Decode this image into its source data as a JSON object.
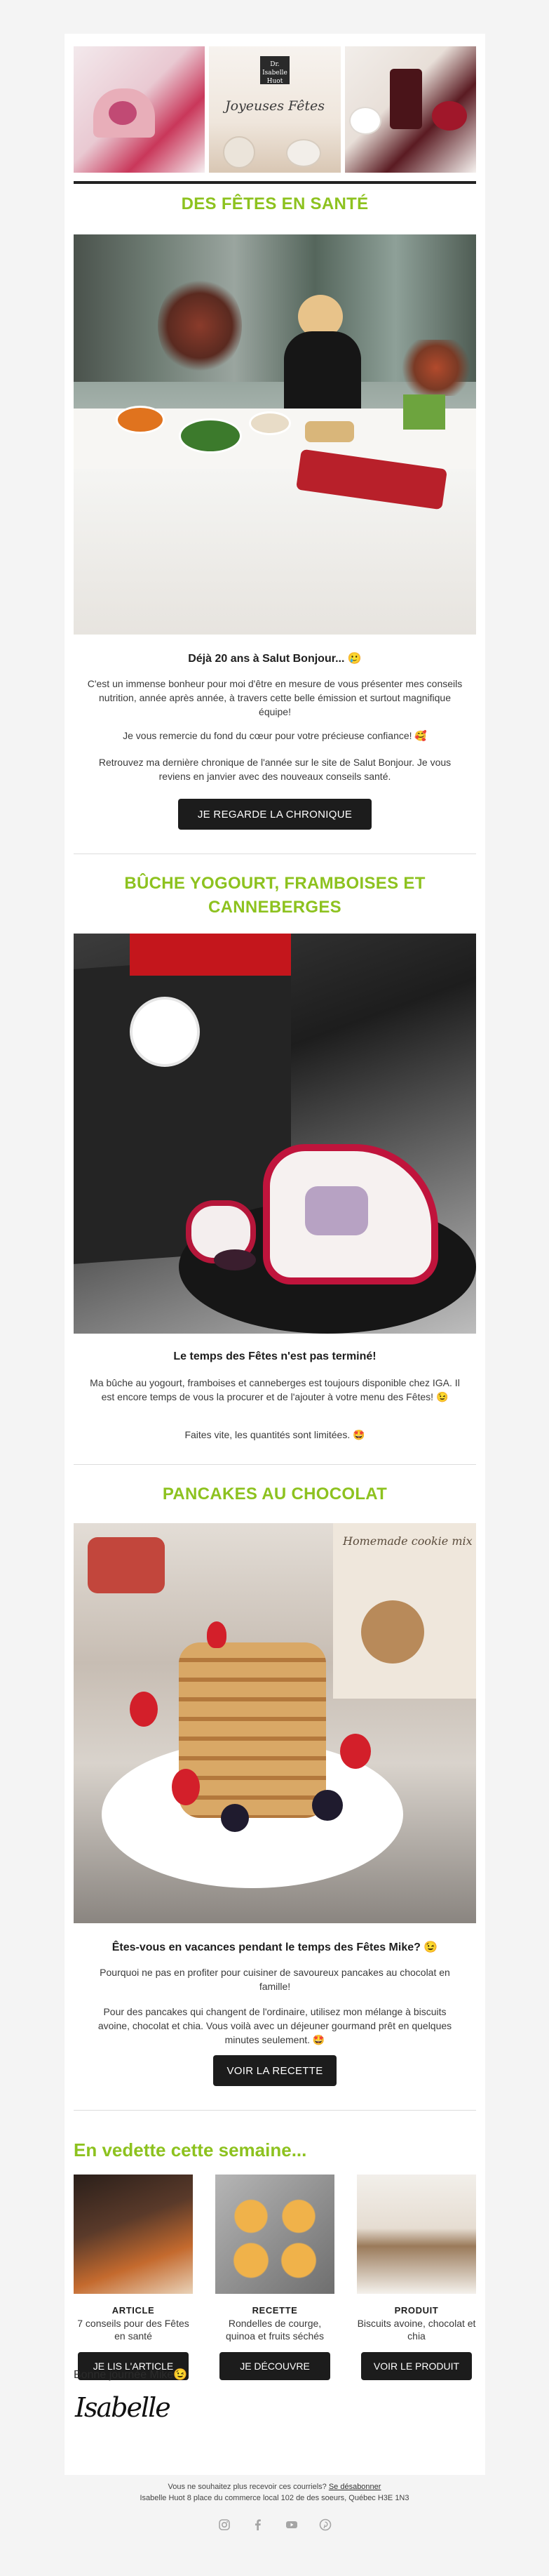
{
  "header": {
    "logo_text": "Dr. Isabelle Huot",
    "banner_script": "Joyeuses Fêtes"
  },
  "section1": {
    "title": "DES FÊTES EN SANTÉ",
    "headline": "Déjà 20 ans à Salut Bonjour... 🥲",
    "paragraphs": [
      "C'est un immense bonheur pour moi d'être en mesure de vous présenter mes conseils nutrition, année après année, à travers cette belle émission et surtout magnifique équipe!",
      "Je vous remercie du fond du cœur pour votre précieuse confiance! 🥰",
      "Retrouvez ma dernière chronique de l'année sur le site de Salut Bonjour. Je vous reviens en janvier avec des nouveaux conseils santé."
    ],
    "cta": "JE REGARDE LA CHRONIQUE"
  },
  "section2": {
    "title": "BÛCHE YOGOURT, FRAMBOISES ET CANNEBERGES",
    "headline": "Le temps des Fêtes n'est pas terminé!",
    "paragraphs": [
      "Ma bûche au yogourt, framboises et canneberges est toujours disponible chez IGA. Il est encore temps de vous la procurer et de l'ajouter à votre menu des Fêtes! 😉",
      "Faites vite, les quantités sont limitées. 🤩"
    ]
  },
  "section3": {
    "title": "PANCAKES AU CHOCOLAT",
    "headline": "Êtes-vous en vacances pendant le temps des Fêtes Mike? 😉",
    "paragraphs": [
      "Pourquoi ne pas en profiter pour cuisiner de savoureux pancakes au chocolat en famille!",
      "Pour des pancakes qui changent de l'ordinaire, utilisez mon mélange à biscuits avoine, chocolat et chia. Vous voilà avec un déjeuner gourmand prêt en quelques minutes seulement. 🤩"
    ],
    "cta": "VOIR LA RECETTE",
    "package_text": "Homemade cookie mix"
  },
  "featured": {
    "title": "En vedette cette semaine...",
    "items": [
      {
        "kind": "ARTICLE",
        "desc": "7 conseils pour des Fêtes en santé",
        "button": "JE LIS L'ARTICLE"
      },
      {
        "kind": "RECETTE",
        "desc": "Rondelles de courge, quinoa et fruits séchés",
        "button": "JE DÉCOUVRE"
      },
      {
        "kind": "PRODUIT",
        "desc": "Biscuits avoine, chocolat et chia",
        "button": "VOIR LE PRODUIT"
      }
    ]
  },
  "signoff": "Bonne journée Mike😉",
  "signature": "Isabelle",
  "footer": {
    "unsubscribe_text": "Vous ne souhaitez plus recevoir ces courriels?",
    "unsubscribe_link": "Se désabonner",
    "address": "Isabelle Huot 8 place du commerce local 102 de des soeurs, Québec H3E 1N3"
  },
  "social_icons": [
    "instagram-icon",
    "facebook-icon",
    "youtube-icon",
    "pinterest-icon"
  ]
}
